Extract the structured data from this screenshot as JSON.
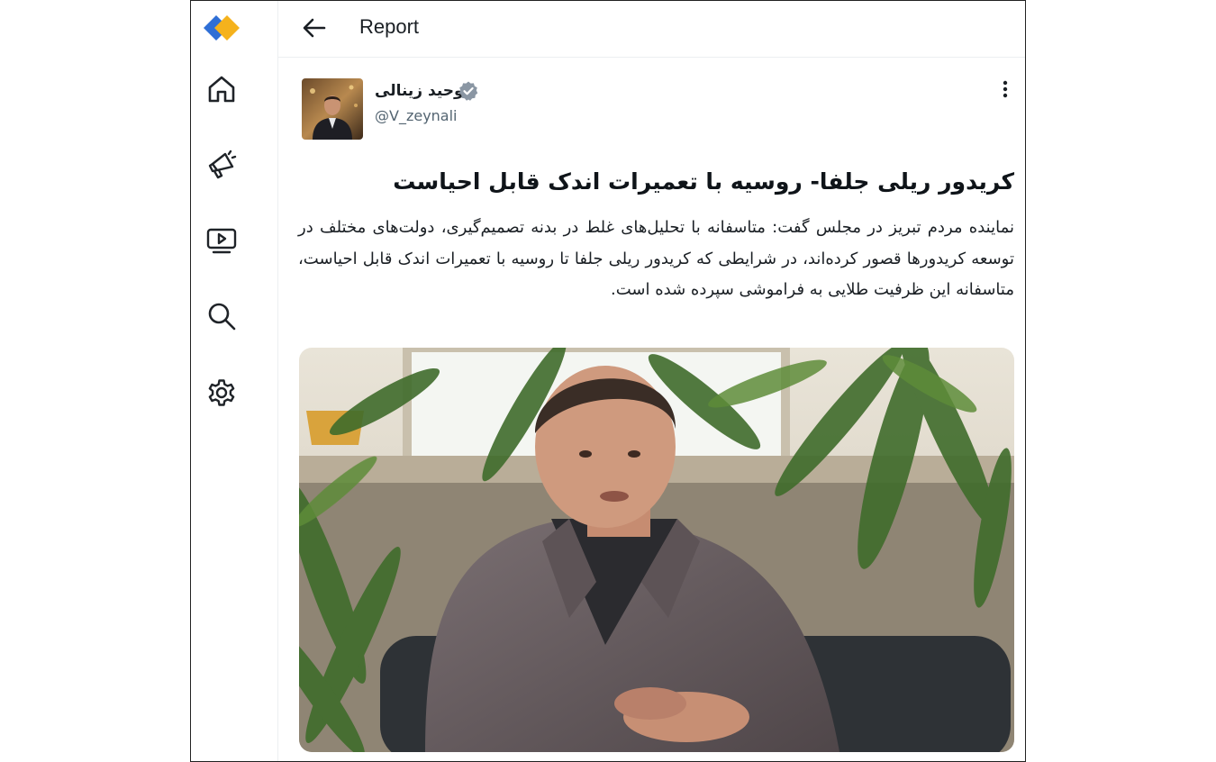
{
  "header": {
    "title": "Report",
    "back_icon": "arrow-left-icon"
  },
  "sidebar": {
    "logo": "app-logo",
    "items": [
      {
        "id": "home",
        "icon": "home-icon"
      },
      {
        "id": "campaigns",
        "icon": "megaphone-icon"
      },
      {
        "id": "media",
        "icon": "play-screen-icon"
      },
      {
        "id": "search",
        "icon": "search-icon"
      },
      {
        "id": "settings",
        "icon": "gear-icon"
      }
    ]
  },
  "post": {
    "author_name": "وحید زینالی",
    "handle": "@V_zeynali",
    "verified": true,
    "headline": "کریدور ریلی جلفا- روسیه با تعمیرات اندک قابل احیاست",
    "body": "نماینده مردم تبریز در مجلس گفت: متاسفانه با تحلیل‌های غلط  در بدنه تصمیم‌گیری، دولت‌های مختلف در توسعه کریدورها قصور کرده‌اند، در شرایطی که کریدور ریلی جلفا تا روسیه با تعمیرات اندک قابل احیاست، متاسفانه این ظرفیت طلایی  به فراموشی سپرده شده است."
  },
  "colors": {
    "logo_blue": "#2f6fd6",
    "logo_orange": "#f5b21c",
    "icon_stroke": "#1f2328",
    "muted_text": "#536471",
    "verified_gray": "#8a96a3"
  }
}
